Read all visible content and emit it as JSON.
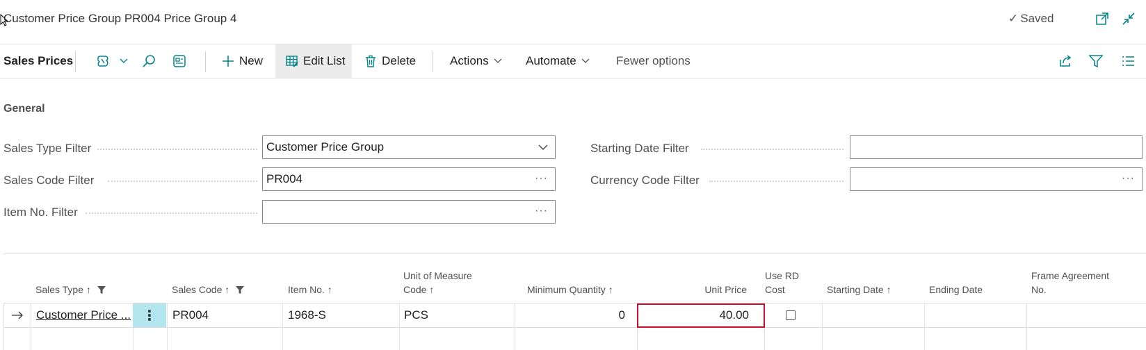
{
  "titlebar": {
    "title": "Customer Price Group PR004 Price Group 4",
    "saved": "Saved"
  },
  "actionbar": {
    "page_title": "Sales Prices",
    "new_label": "New",
    "edit_list_label": "Edit List",
    "delete_label": "Delete",
    "actions_label": "Actions",
    "automate_label": "Automate",
    "fewer_label": "Fewer options"
  },
  "general": {
    "section_title": "General",
    "sales_type_filter_label": "Sales Type Filter",
    "sales_type_filter_value": "Customer Price Group",
    "sales_code_filter_label": "Sales Code Filter",
    "sales_code_filter_value": "PR004",
    "item_no_filter_label": "Item No. Filter",
    "item_no_filter_value": "",
    "starting_date_filter_label": "Starting Date Filter",
    "starting_date_filter_value": "",
    "currency_code_filter_label": "Currency Code Filter",
    "currency_code_filter_value": ""
  },
  "grid": {
    "headers": {
      "sales_type": "Sales Type",
      "sales_code": "Sales Code",
      "item_no": "Item No.",
      "uom_1": "Unit of Measure",
      "uom_2": "Code",
      "min_qty": "Minimum Quantity",
      "unit_price": "Unit Price",
      "use_rd_1": "Use RD",
      "use_rd_2": "Cost",
      "starting_date": "Starting Date",
      "ending_date": "Ending Date",
      "frame_1": "Frame Agreement",
      "frame_2": "No."
    },
    "rows": [
      {
        "sales_type": "Customer Price ...",
        "sales_code": "PR004",
        "item_no": "1968-S",
        "uom": "PCS",
        "min_qty": "0",
        "unit_price": "40.00",
        "use_rd_cost": false,
        "starting_date": "",
        "ending_date": "",
        "frame_agreement": ""
      }
    ]
  },
  "colors": {
    "accent": "#008489",
    "selected_border": "#c8102e",
    "row_action_bg": "#b3e5ee"
  }
}
